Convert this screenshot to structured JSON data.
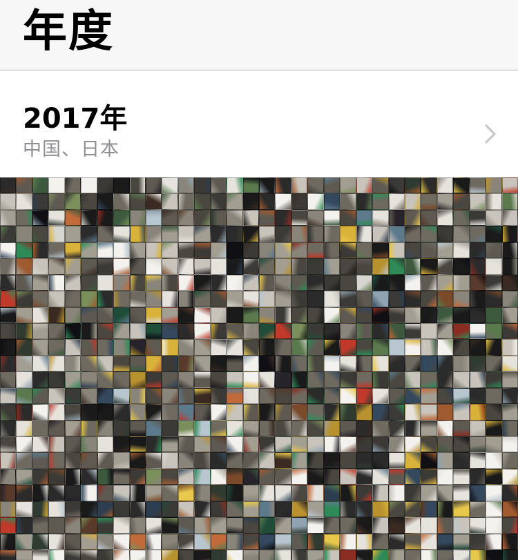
{
  "header": {
    "title": "年度"
  },
  "year_section": {
    "title": "2017年",
    "subtitle": "中国、日本"
  },
  "icons": {
    "chevron": "chevron-right-icon"
  },
  "colors": {
    "header_bg": "#f7f7f7",
    "divider": "#b2b2b2",
    "subtitle": "#8e8e93",
    "chevron": "#c7c7cc"
  },
  "mosaic_palette": [
    "#1a1a1a",
    "#2b2b2b",
    "#3c3a36",
    "#4a4640",
    "#5e5a52",
    "#6f6a60",
    "#8a857a",
    "#a39e92",
    "#c8c4bb",
    "#e6e3dd",
    "#f4f2ee",
    "#2f3a30",
    "#3d5a3f",
    "#5a7a4e",
    "#7a8f5c",
    "#b7922f",
    "#d9b23a",
    "#e8c84a",
    "#7a4a2a",
    "#a05a30",
    "#c26a3a",
    "#8b2d22",
    "#c0392b",
    "#2c3e50",
    "#34495e",
    "#5d7a8c",
    "#8fa3b0",
    "#b8c6cf",
    "#1f4d3a",
    "#2e8b57",
    "#3a2a22",
    "#5a3a2a",
    "#0f0f14",
    "#26232a",
    "#d8d6d0"
  ]
}
